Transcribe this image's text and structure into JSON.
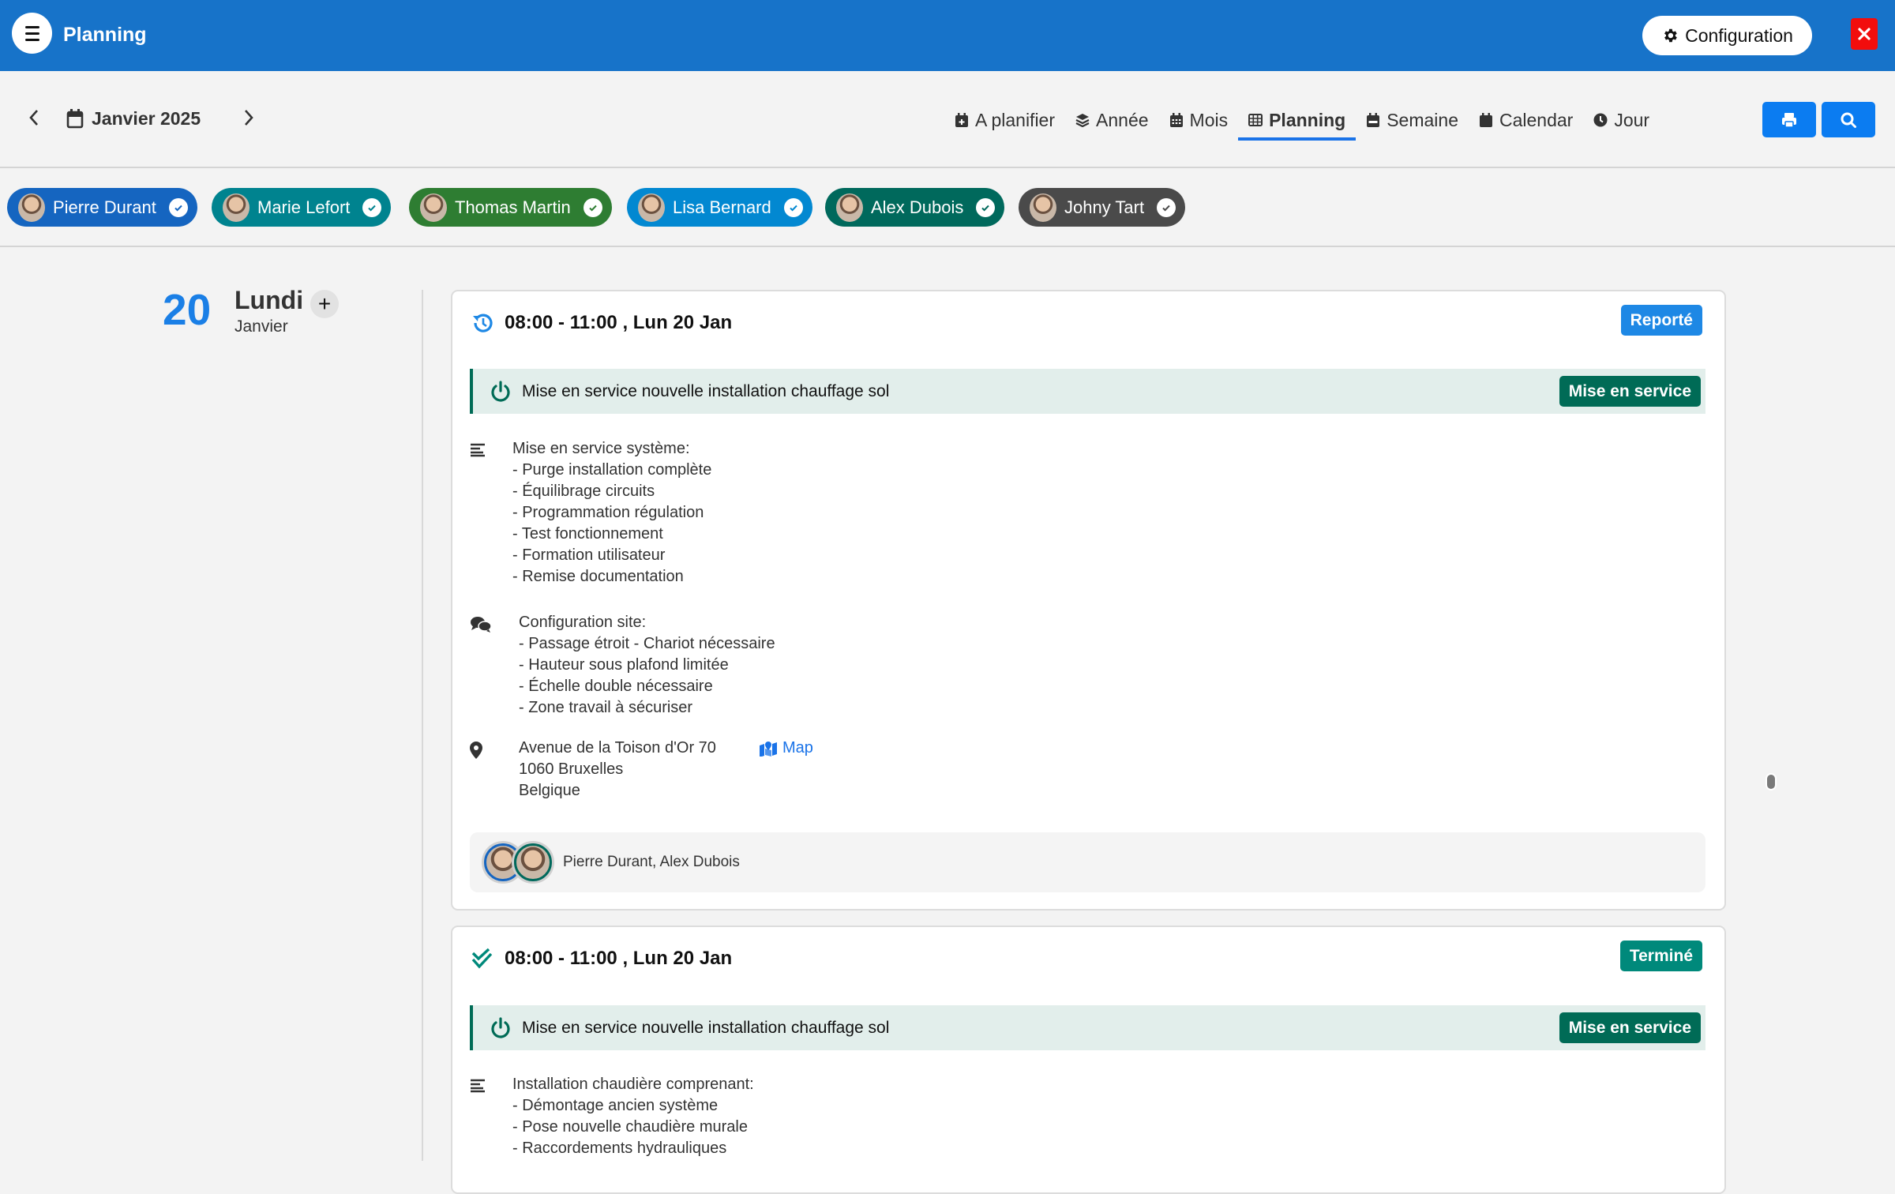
{
  "header": {
    "title": "Planning",
    "config_label": "Configuration",
    "colors": {
      "bar": "#1773c9",
      "close": "#f20d0d"
    }
  },
  "toolbar": {
    "period_label": "Janvier 2025",
    "views": [
      {
        "label": "A planifier",
        "icon": "calendar-plus-icon",
        "active": false
      },
      {
        "label": "Année",
        "icon": "layers-icon",
        "active": false
      },
      {
        "label": "Mois",
        "icon": "calendar-grid-icon",
        "active": false
      },
      {
        "label": "Planning",
        "icon": "table-icon",
        "active": true
      },
      {
        "label": "Semaine",
        "icon": "calendar-week-icon",
        "active": false
      },
      {
        "label": "Calendar",
        "icon": "calendar-icon",
        "active": false
      },
      {
        "label": "Jour",
        "icon": "clock-icon",
        "active": false
      }
    ]
  },
  "employees": [
    {
      "name": "Pierre Durant",
      "color": "#1565c0",
      "selected": true
    },
    {
      "name": "Marie Lefort",
      "color": "#00838f",
      "selected": true
    },
    {
      "name": "Thomas Martin",
      "color": "#2e7d32",
      "selected": true
    },
    {
      "name": "Lisa Bernard",
      "color": "#0288d1",
      "selected": true
    },
    {
      "name": "Alex Dubois",
      "color": "#00695c",
      "selected": true
    },
    {
      "name": "Johny Tart",
      "color": "#4a4a4a",
      "selected": true
    }
  ],
  "day": {
    "number": "20",
    "weekday": "Lundi",
    "month": "Janvier",
    "add_label": "+"
  },
  "events": [
    {
      "time": "08:00 - 11:00 , Lun 20 Jan",
      "status_icon": "history-icon",
      "status": "Reporté",
      "status_color": "#1e88e5",
      "type_title": "Mise en service nouvelle installation chauffage sol",
      "type_badge": "Mise en service",
      "description": "Mise en service système:\n- Purge installation complète\n- Équilibrage circuits\n- Programmation régulation\n- Test fonctionnement\n- Formation utilisateur\n- Remise documentation",
      "notes": "Configuration site:\n- Passage étroit - Chariot nécessaire\n- Hauteur sous plafond limitée\n- Échelle double nécessaire\n- Zone travail à sécuriser",
      "address": "Avenue de la Toison d'Or 70\n1060 Bruxelles\nBelgique",
      "map_label": "Map",
      "assignees": "Pierre Durant, Alex Dubois"
    },
    {
      "time": "08:00 - 11:00 , Lun 20 Jan",
      "status_icon": "double-check-icon",
      "status": "Terminé",
      "status_color": "#00897b",
      "type_title": "Mise en service nouvelle installation chauffage sol",
      "type_badge": "Mise en service",
      "description": "Installation chaudière comprenant:\n- Démontage ancien système\n- Pose nouvelle chaudière murale\n- Raccordements hydrauliques"
    }
  ]
}
